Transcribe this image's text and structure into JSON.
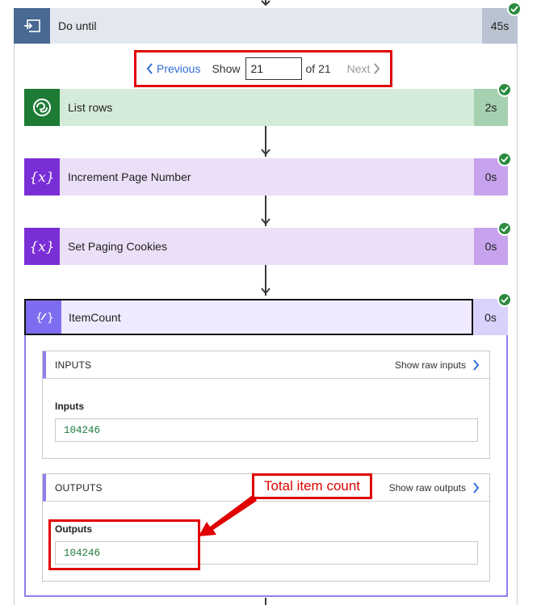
{
  "do_until": {
    "title": "Do until",
    "duration": "45s"
  },
  "pager": {
    "previous_label": "Previous",
    "show_label": "Show",
    "current_value": "21",
    "of_label": "of 21",
    "next_label": "Next"
  },
  "actions": [
    {
      "label": "List rows",
      "duration": "2s",
      "icon": "dataverse-icon"
    },
    {
      "label": "Increment Page Number",
      "duration": "0s",
      "icon": "variable-icon"
    },
    {
      "label": "Set Paging Cookies",
      "duration": "0s",
      "icon": "variable-icon"
    }
  ],
  "item_count": {
    "label": "ItemCount",
    "duration": "0s",
    "inputs": {
      "heading": "INPUTS",
      "raw_link": "Show raw inputs",
      "field_label": "Inputs",
      "value": "104246"
    },
    "outputs": {
      "heading": "OUTPUTS",
      "raw_link": "Show raw outputs",
      "field_label": "Outputs",
      "value": "104246"
    }
  },
  "annotation": {
    "text": "Total item count"
  },
  "colors": {
    "success": "#2b8a3e",
    "annotation_red": "#e00000",
    "link_blue": "#2f6fd6",
    "loop_blue": "#486991",
    "dataverse_green": "#1e7b34",
    "variable_purple": "#7a2ed6",
    "compose_purple": "#7e6df0"
  }
}
